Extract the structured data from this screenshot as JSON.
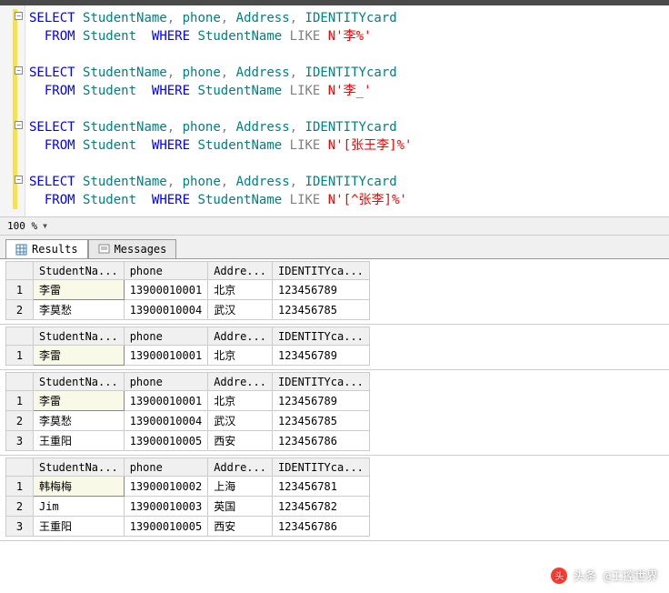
{
  "queries": [
    {
      "select": "SELECT",
      "cols": [
        "StudentName",
        "phone",
        "Address",
        "IDENTITYcard"
      ],
      "from": "FROM",
      "table": "Student",
      "where": "WHERE",
      "whereCol": "StudentName",
      "like": "LIKE",
      "prefix": "N",
      "literal": "'李%'"
    },
    {
      "select": "SELECT",
      "cols": [
        "StudentName",
        "phone",
        "Address",
        "IDENTITYcard"
      ],
      "from": "FROM",
      "table": "Student",
      "where": "WHERE",
      "whereCol": "StudentName",
      "like": "LIKE",
      "prefix": "N",
      "literal": "'李_'"
    },
    {
      "select": "SELECT",
      "cols": [
        "StudentName",
        "phone",
        "Address",
        "IDENTITYcard"
      ],
      "from": "FROM",
      "table": "Student",
      "where": "WHERE",
      "whereCol": "StudentName",
      "like": "LIKE",
      "prefix": "N",
      "literal": "'[张王李]%'"
    },
    {
      "select": "SELECT",
      "cols": [
        "StudentName",
        "phone",
        "Address",
        "IDENTITYcard"
      ],
      "from": "FROM",
      "table": "Student",
      "where": "WHERE",
      "whereCol": "StudentName",
      "like": "LIKE",
      "prefix": "N",
      "literal": "'[^张李]%'"
    }
  ],
  "zoom": {
    "value": "100 %"
  },
  "tabs": {
    "results": "Results",
    "messages": "Messages"
  },
  "headers": [
    "StudentNa...",
    "phone",
    "Addre...",
    "IDENTITYca..."
  ],
  "resultSets": [
    [
      {
        "StudentName": "李雷",
        "phone": "13900010001",
        "Address": "北京",
        "IDENTITYcard": "123456789"
      },
      {
        "StudentName": "李莫愁",
        "phone": "13900010004",
        "Address": "武汉",
        "IDENTITYcard": "123456785"
      }
    ],
    [
      {
        "StudentName": "李雷",
        "phone": "13900010001",
        "Address": "北京",
        "IDENTITYcard": "123456789"
      }
    ],
    [
      {
        "StudentName": "李雷",
        "phone": "13900010001",
        "Address": "北京",
        "IDENTITYcard": "123456789"
      },
      {
        "StudentName": "李莫愁",
        "phone": "13900010004",
        "Address": "武汉",
        "IDENTITYcard": "123456785"
      },
      {
        "StudentName": "王重阳",
        "phone": "13900010005",
        "Address": "西安",
        "IDENTITYcard": "123456786"
      }
    ],
    [
      {
        "StudentName": "韩梅梅",
        "phone": "13900010002",
        "Address": "上海",
        "IDENTITYcard": "123456781"
      },
      {
        "StudentName": "Jim",
        "phone": "13900010003",
        "Address": "英国",
        "IDENTITYcard": "123456782"
      },
      {
        "StudentName": "王重阳",
        "phone": "13900010005",
        "Address": "西安",
        "IDENTITYcard": "123456786"
      }
    ]
  ],
  "watermark": {
    "text": "头条 @工控世界"
  }
}
